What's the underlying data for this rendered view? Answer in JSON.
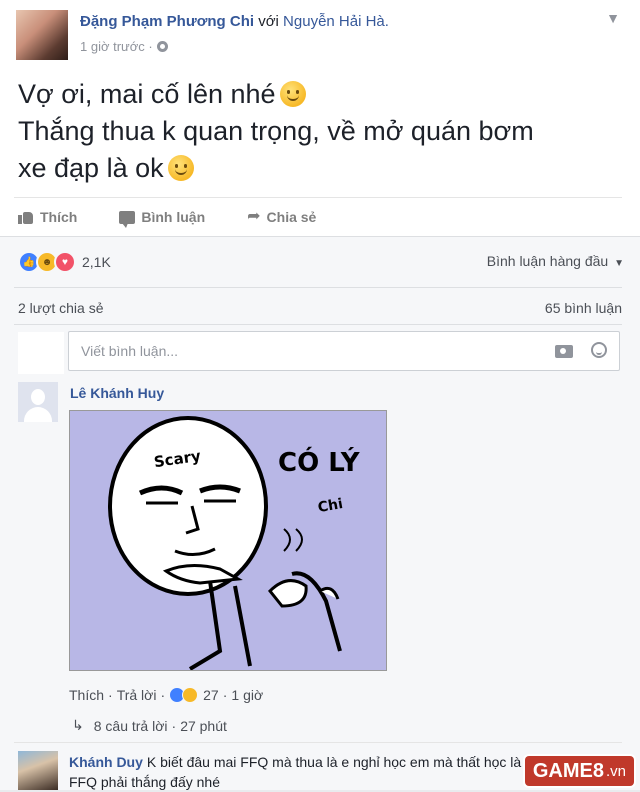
{
  "post": {
    "author": "Đặng Phạm Phương Chi",
    "with_text": "với",
    "tagged": "Nguyễn Hải Hà.",
    "time": "1 giờ trước ·",
    "lines": [
      "Vợ ơi, mai cố lên nhé",
      "Thắng thua k quan trọng, về mở quán bơm",
      "xe đạp là ok"
    ]
  },
  "actions": {
    "like": "Thích",
    "comment": "Bình luận",
    "share": "Chia sẻ"
  },
  "stats": {
    "reaction_count": "2,1K",
    "sort_label": "Bình luận hàng đầu",
    "shares": "2 lượt chia sẻ",
    "comments": "65 bình luận"
  },
  "composer": {
    "placeholder": "Viết bình luận..."
  },
  "comment1": {
    "name": "Lê Khánh Huy",
    "meme": {
      "top": "Scary",
      "caption": "CÓ LÝ",
      "sub": "Chi"
    },
    "like": "Thích",
    "reply": "Trả lời",
    "reaction_count": "27",
    "time": "1 giờ",
    "replies": "8 câu trả lời",
    "replies_time": "27 phút"
  },
  "comment2": {
    "name": "Khánh Duy",
    "text": "K biết đâu mai FFQ mà thua là e nghỉ học em mà thất học là do team FFQ phải thắng đấy nhé"
  },
  "watermark": {
    "brand": "GAME8",
    "tld": ".vn"
  },
  "colors": {
    "link": "#365899",
    "like": "#4080ff",
    "love": "#f25268",
    "haha": "#f7b928"
  },
  "icons": [
    "chevron-down-icon",
    "globe-icon",
    "like-icon",
    "comment-icon",
    "share-icon",
    "camera-icon",
    "emoji-icon"
  ]
}
